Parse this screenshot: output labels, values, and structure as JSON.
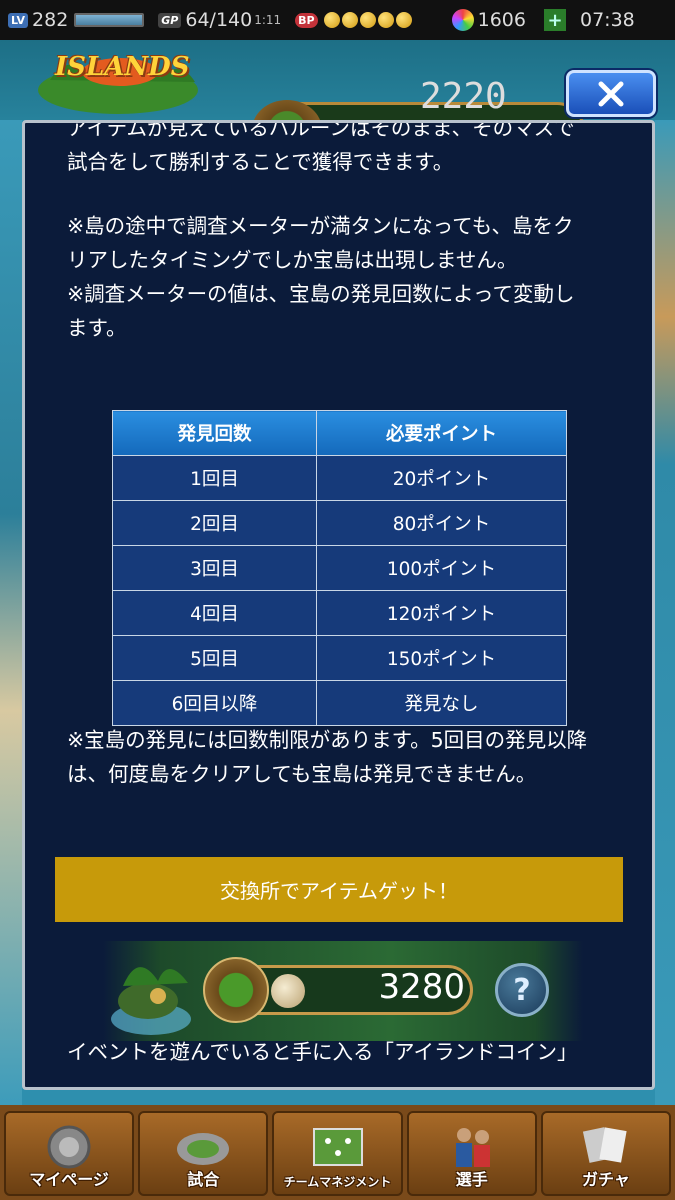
{
  "status_bar": {
    "level_label": "LV",
    "level_value": "282",
    "gp_label": "GP",
    "gp_value": "64/140",
    "gp_timer": "1:11",
    "bp_label": "BP",
    "gems": "1606",
    "clock": "07:38"
  },
  "header": {
    "logo_text": "ISLANDS",
    "coin_value": "2220"
  },
  "modal": {
    "para1": "アイテムが見えているバルーンはそのまま、そのマスで\n試合をして勝利することで獲得できます。",
    "para2": "※島の途中で調査メーターが満タンになっても、島をク\nリアしたタイミングでしか宝島は出現しません。\n※調査メーターの値は、宝島の発見回数によって変動し\nます。",
    "table": {
      "headers": [
        "発見回数",
        "必要ポイント"
      ],
      "rows": [
        [
          "1回目",
          "20ポイント"
        ],
        [
          "2回目",
          "80ポイント"
        ],
        [
          "3回目",
          "100ポイント"
        ],
        [
          "4回目",
          "120ポイント"
        ],
        [
          "5回目",
          "150ポイント"
        ],
        [
          "6回目以降",
          "発見なし"
        ]
      ]
    },
    "para3": "※宝島の発見には回数制限があります。5回目の発見以降\nは、何度島をクリアしても宝島は発見できません。",
    "exchange_button": "交換所でアイテムゲット！",
    "coin_banner_value": "3280",
    "help_label": "?",
    "para4": "イベントを遊んでいると手に入る「アイランドコイン」"
  },
  "bottom_nav": [
    {
      "label": "マイページ"
    },
    {
      "label": "試合"
    },
    {
      "label": "チームマネジメント"
    },
    {
      "label": "選手"
    },
    {
      "label": "ガチャ"
    }
  ],
  "colors": {
    "modal_bg": "#0b1b3a",
    "table_header": "#1f7dd0",
    "table_cell": "#163a7a",
    "exchange_button": "#c79a0a"
  }
}
